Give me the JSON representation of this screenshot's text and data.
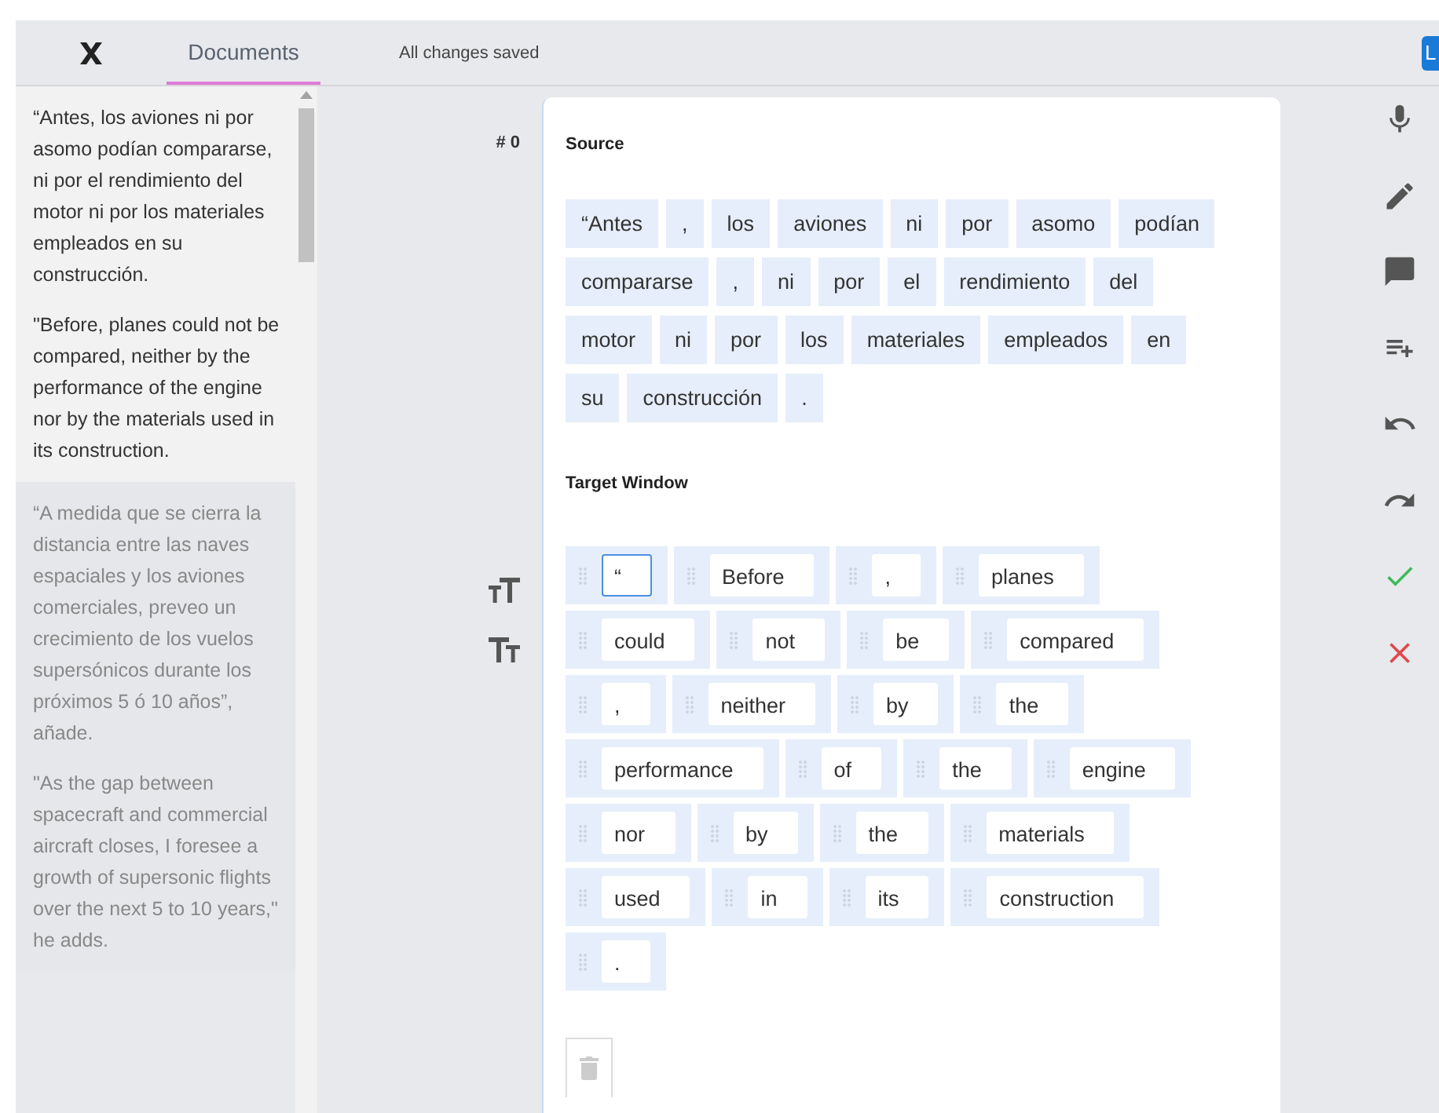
{
  "header": {
    "tab": {
      "label": "Documents",
      "selected": true
    },
    "status": "All changes saved",
    "button": "L"
  },
  "segments": [
    {
      "selected": true,
      "source": "“Antes, los aviones ni por asomo podían compararse, ni por el rendimiento del motor ni por los materiales empleados en su construcción.",
      "target": "\"Before, planes could not be compared, neither by the performance of the engine nor by the materials used in its construction."
    },
    {
      "selected": false,
      "source": "“A medida que se cierra la distancia entre las naves espaciales y los aviones comerciales, preveo un crecimiento de los vuelos supersónicos durante los próximos 5 ó 10 años”, añade.",
      "target": "\"As the gap between spacecraft and commercial aircraft closes, I foresee a growth of supersonic flights over the next 5 to 10 years,\" he adds."
    }
  ],
  "editor": {
    "number": "# 0",
    "source_label": "Source",
    "target_label": "Target Window",
    "source_tokens": [
      "“Antes",
      ",",
      "los",
      "aviones",
      "ni",
      "por",
      "asomo",
      "podían",
      "compararse",
      ",",
      "ni",
      "por",
      "el",
      "rendimiento",
      "del",
      "motor",
      "ni",
      "por",
      "los",
      "materiales",
      "empleados",
      "en",
      "su",
      "construcción",
      "."
    ],
    "target_tokens": [
      {
        "text": "“",
        "focused": true
      },
      {
        "text": "Before",
        "focused": false
      },
      {
        "text": ",",
        "focused": false
      },
      {
        "text": "planes",
        "focused": false
      },
      {
        "text": "could",
        "focused": false
      },
      {
        "text": "not",
        "focused": false
      },
      {
        "text": "be",
        "focused": false
      },
      {
        "text": "compared",
        "focused": false
      },
      {
        "text": ",",
        "focused": false
      },
      {
        "text": "neither",
        "focused": false
      },
      {
        "text": "by",
        "focused": false
      },
      {
        "text": "the",
        "focused": false
      },
      {
        "text": "performance",
        "focused": false
      },
      {
        "text": "of",
        "focused": false
      },
      {
        "text": "the",
        "focused": false
      },
      {
        "text": "engine",
        "focused": false
      },
      {
        "text": "nor",
        "focused": false
      },
      {
        "text": "by",
        "focused": false
      },
      {
        "text": "the",
        "focused": false
      },
      {
        "text": "materials",
        "focused": false
      },
      {
        "text": "used",
        "focused": false
      },
      {
        "text": "in",
        "focused": false
      },
      {
        "text": "its",
        "focused": false
      },
      {
        "text": "construction",
        "focused": false
      },
      {
        "text": ".",
        "focused": false
      }
    ]
  },
  "tools": [
    {
      "kind": "mic"
    },
    {
      "kind": "pencil"
    },
    {
      "kind": "comment"
    },
    {
      "kind": "add-list"
    },
    {
      "kind": "undo"
    },
    {
      "kind": "redo"
    },
    {
      "kind": "check"
    },
    {
      "kind": "close"
    }
  ]
}
